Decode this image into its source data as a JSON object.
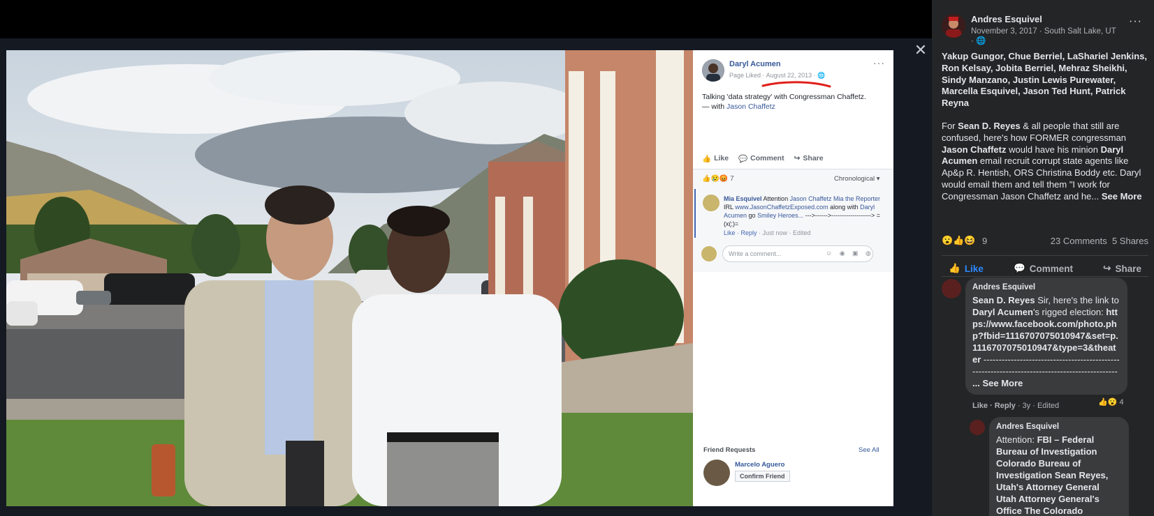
{
  "viewer": {
    "close_label": "✕"
  },
  "inner_post": {
    "author": "Daryl Acumen",
    "meta_prefix": "Page Liked ·",
    "date": "August 22, 2013",
    "meta_suffix": "· 🌐",
    "more": "···",
    "text": "Talking 'data strategy' with Congressman Chaffetz.",
    "with_prefix": "— with",
    "with_name": "Jason Chaffetz",
    "actions": {
      "like": "Like",
      "comment": "Comment",
      "share": "Share"
    },
    "reactions_count": "7",
    "sort_label": "Chronological ▾",
    "comment": {
      "author": "Mia Esquivel",
      "text_1": "Attention",
      "link_1": "Jason Chaffetz",
      "link_2": "Mia the Reporter",
      "text_2": "IRL",
      "link_3": "www.JasonChaffetzExposed.com",
      "text_3": "along with",
      "link_4": "Daryl Acumen",
      "text_4": "go",
      "link_5": "Smiley Heroes...",
      "text_5": "--->------>-------------------> =(x(;)=",
      "like": "Like",
      "reply": "Reply",
      "time": "· Just now · Edited"
    },
    "write_placeholder": "Write a comment...",
    "friend_requests": {
      "title": "Friend Requests",
      "see_all": "See All",
      "name": "Marcelo Aguero",
      "confirm": "Confirm Friend"
    }
  },
  "post": {
    "author": "Andres Esquivel",
    "date": "November 3, 2017 · South Salt Lake, UT · 🌐",
    "more": "···",
    "tags": "Yakup Gungor, Chue Berriel, LaShariel Jenkins, Ron Kelsay, Jobita Berriel, Mehraz Sheikhi, Sindy Manzano, Justin Lewis Purewater, Marcella Esquivel, Jason Ted Hunt, Patrick Reyna",
    "body": {
      "t1": "For",
      "b1": "Sean D. Reyes",
      "t2": "& all people that still are confused, here's how FORMER congressman",
      "b2": "Jason Chaffetz",
      "t3": "would have his minion",
      "b3": "Daryl Acumen",
      "t4": "email recruit corrupt state agents like Ap&p R. Hentish, ORS Christina Boddy etc. Daryl would email them and tell them \"I work for Congressman Jason Chaffetz and he...",
      "see_more": "See More"
    },
    "reaction_count": "9",
    "comments_count": "23 Comments",
    "shares_count": "5 Shares",
    "actions": {
      "like": "Like",
      "comment": "Comment",
      "share": "Share"
    }
  },
  "comments": [
    {
      "author": "Andres Esquivel",
      "b1": "Sean D. Reyes",
      "t1": "Sir, here's the link to",
      "b2": "Daryl Acumen",
      "t2": "'s rigged election:",
      "link": "https://www.facebook.com/photo.php?fbid=1116707075010947&set=p.1116707075010947&type=3&theater",
      "t3": "---------------------------------------------------------------------------------------------",
      "see_more": "... See More",
      "like": "Like",
      "reply": "Reply",
      "time": "· 3y · Edited",
      "reacts": "4"
    },
    {
      "author": "Andres Esquivel",
      "t1": "Attention:",
      "b1": "FBI – Federal Bureau of Investigation Colorado Bureau of Investigation Sean Reyes, Utah's Attorney General Utah Attorney General's Office The Colorado Attorney General's Office"
    }
  ],
  "colors": {
    "panel_bg": "#242526",
    "bubble_bg": "#3a3b3c",
    "link_blue": "#2d88ff",
    "fb_link": "#365899",
    "underline_red": "#e0201a"
  }
}
